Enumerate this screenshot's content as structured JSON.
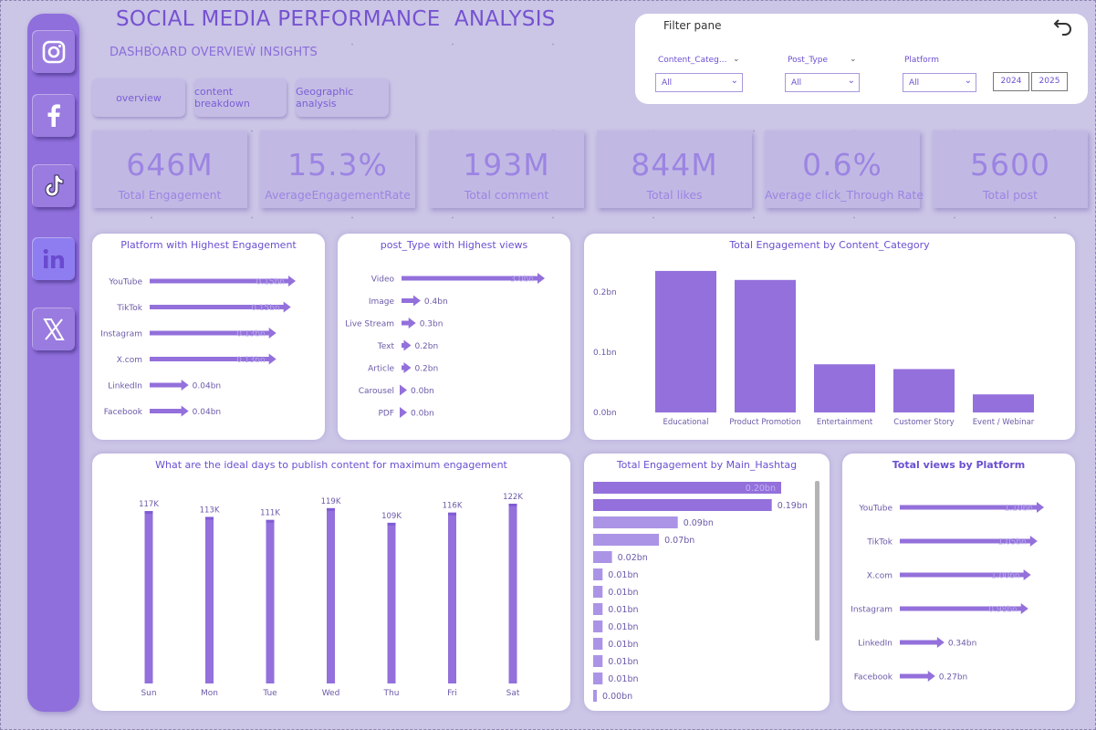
{
  "header": {
    "title": "SOCIAL MEDIA PERFORMANCE  ANALYSIS",
    "subtitle": "DASHBOARD OVERVIEW INSIGHTS"
  },
  "nav": {
    "overview": "overview",
    "content_breakdown": "content breakdown",
    "geographic": "Geographic analysis"
  },
  "sidebar": {
    "icons": [
      "instagram-icon",
      "facebook-icon",
      "tiktok-icon",
      "linkedin-icon",
      "x-icon"
    ]
  },
  "filter_pane": {
    "title": "Filter pane",
    "content_category_label": "Content_Categ...",
    "content_category_value": "All",
    "post_type_label": "Post_Type",
    "post_type_value": "All",
    "platform_label": "Platform",
    "platform_value": "All",
    "year_1": "2024",
    "year_2": "2025"
  },
  "kpis": [
    {
      "value": "646M",
      "label": "Total Engagement"
    },
    {
      "value": "15.3%",
      "label": "AverageEngagementRate"
    },
    {
      "value": "193M",
      "label": "Total comment"
    },
    {
      "value": "844M",
      "label": "Total likes"
    },
    {
      "value": "0.6%",
      "label": "Average click_Through Rate"
    },
    {
      "value": "5600",
      "label": "Total post"
    }
  ],
  "colors": {
    "accent": "#9370db",
    "panel": "#ffffff",
    "background": "#cbc5e6",
    "sidebar": "#8f6fdb"
  },
  "chart_data": [
    {
      "id": "platform_engagement",
      "type": "bar",
      "orientation": "horizontal",
      "title": "Platform with Highest Engagement",
      "categories": [
        "YouTube",
        "TikTok",
        "Instagram",
        "X.com",
        "LinkedIn",
        "Facebook"
      ],
      "values": [
        0.15,
        0.145,
        0.13,
        0.13,
        0.04,
        0.04
      ],
      "labels": [
        "0.15bn",
        "0.15bn",
        "0.13bn",
        "0.13bn",
        "0.04bn",
        "0.04bn"
      ]
    },
    {
      "id": "post_type_views",
      "type": "bar",
      "orientation": "horizontal",
      "title": "post_Type with Highest views",
      "categories": [
        "Video",
        "Image",
        "Live Stream",
        "Text",
        "Article",
        "Carousel",
        "PDF"
      ],
      "values": [
        3.0,
        0.4,
        0.3,
        0.2,
        0.2,
        0.0,
        0.0
      ],
      "labels": [
        "3.0bn",
        "0.4bn",
        "0.3bn",
        "0.2bn",
        "0.2bn",
        "0.0bn",
        "0.0bn"
      ]
    },
    {
      "id": "content_category_engagement",
      "type": "bar",
      "title": "Total Engagement by Content_Category",
      "categories": [
        "Educational",
        "Product Promotion",
        "Entertainment",
        "Customer Story",
        "Event / Webinar"
      ],
      "values": [
        0.235,
        0.22,
        0.08,
        0.072,
        0.03
      ],
      "ylim": [
        0,
        0.25
      ],
      "yticks": [
        "0.0bn",
        "0.1bn",
        "0.2bn"
      ]
    },
    {
      "id": "ideal_days",
      "type": "bar",
      "title": "What are the ideal days to publish content for maximum engagement",
      "categories": [
        "Sun",
        "Mon",
        "Tue",
        "Wed",
        "Thu",
        "Fri",
        "Sat"
      ],
      "values": [
        117,
        113,
        111,
        119,
        109,
        116,
        122
      ],
      "labels": [
        "117K",
        "113K",
        "111K",
        "119K",
        "109K",
        "116K",
        "122K"
      ]
    },
    {
      "id": "main_hashtag",
      "type": "bar",
      "orientation": "horizontal",
      "title": "Total Engagement by Main_Hashtag",
      "values": [
        0.2,
        0.19,
        0.09,
        0.07,
        0.02,
        0.01,
        0.01,
        0.01,
        0.01,
        0.01,
        0.01,
        0.01,
        0.0
      ],
      "labels": [
        "0.20bn",
        "0.19bn",
        "0.09bn",
        "0.07bn",
        "0.02bn",
        "0.01bn",
        "0.01bn",
        "0.01bn",
        "0.01bn",
        "0.01bn",
        "0.01bn",
        "0.01bn",
        "0.00bn"
      ]
    },
    {
      "id": "views_by_platform",
      "type": "bar",
      "orientation": "horizontal",
      "title": "Total views by Platform",
      "categories": [
        "YouTube",
        "TikTok",
        "X.com",
        "Instagram",
        "LinkedIn",
        "Facebook"
      ],
      "values": [
        1.1,
        1.05,
        1.0,
        0.98,
        0.34,
        0.27
      ],
      "labels": [
        "1.10bn",
        "1.05bn",
        "1.00bn",
        "0.98bn",
        "0.34bn",
        "0.27bn"
      ]
    }
  ]
}
